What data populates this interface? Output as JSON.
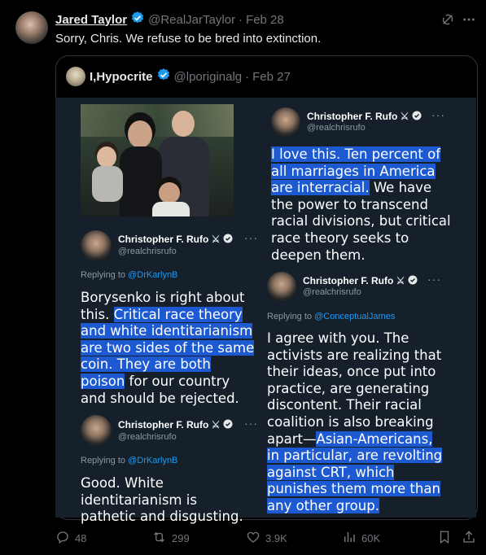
{
  "tweet": {
    "author_name": "Jared Taylor",
    "author_handle": "@RealJarTaylor",
    "separator": "·",
    "date": "Feb 28",
    "text": "Sorry, Chris. We refuse to be bred into extinction."
  },
  "quote": {
    "author_name": "I,Hypocrite",
    "author_handle": "@lporiginalg",
    "separator": "·",
    "date": "Feb 27"
  },
  "screenshot": {
    "left_top": {
      "name": "Christopher F. Rufo",
      "handle": "@realchrisrufo",
      "reply_label": "Replying to",
      "reply_to": "@DrKarlynB"
    },
    "left_top_text_plain1": "Borysenko is right about this. ",
    "left_top_text_hl": "Critical race theory and white identitarianism are two sides of the same coin. They are both poison",
    "left_top_text_plain2": " for our country and should be rejected.",
    "left_bottom": {
      "name": "Christopher F. Rufo",
      "handle": "@realchrisrufo",
      "reply_label": "Replying to",
      "reply_to": "@DrKarlynB"
    },
    "left_bottom_text": "Good. White identitarianism is pathetic and disgusting.",
    "right_top": {
      "name": "Christopher F. Rufo",
      "handle": "@realchrisrufo"
    },
    "right_top_text_hl": "I love this. Ten percent of all marriages in America are interracial.",
    "right_top_text_plain": " We have the power to transcend racial divisions, but critical race theory seeks to deepen them.",
    "right_bottom": {
      "name": "Christopher F. Rufo",
      "handle": "@realchrisrufo",
      "reply_label": "Replying to",
      "reply_to": "@ConceptualJames"
    },
    "right_bottom_text_plain": "I agree with you. The activists are realizing that their ideas, once put into practice, are generating discontent. Their racial coalition is also breaking apart—",
    "right_bottom_text_hl": "Asian-Americans, in particular, are revolting against CRT, which punishes them more than any other group."
  },
  "actions": {
    "replies": "48",
    "reposts": "299",
    "likes": "3.9K",
    "views": "60K"
  },
  "icons": [
    "grok-icon",
    "more-icon",
    "verified-icon",
    "reply-icon",
    "repost-icon",
    "like-icon",
    "views-icon",
    "bookmark-icon",
    "share-icon"
  ],
  "colors": {
    "accent": "#1d9bf0",
    "highlight": "#1d5ad1",
    "background": "#000000"
  }
}
